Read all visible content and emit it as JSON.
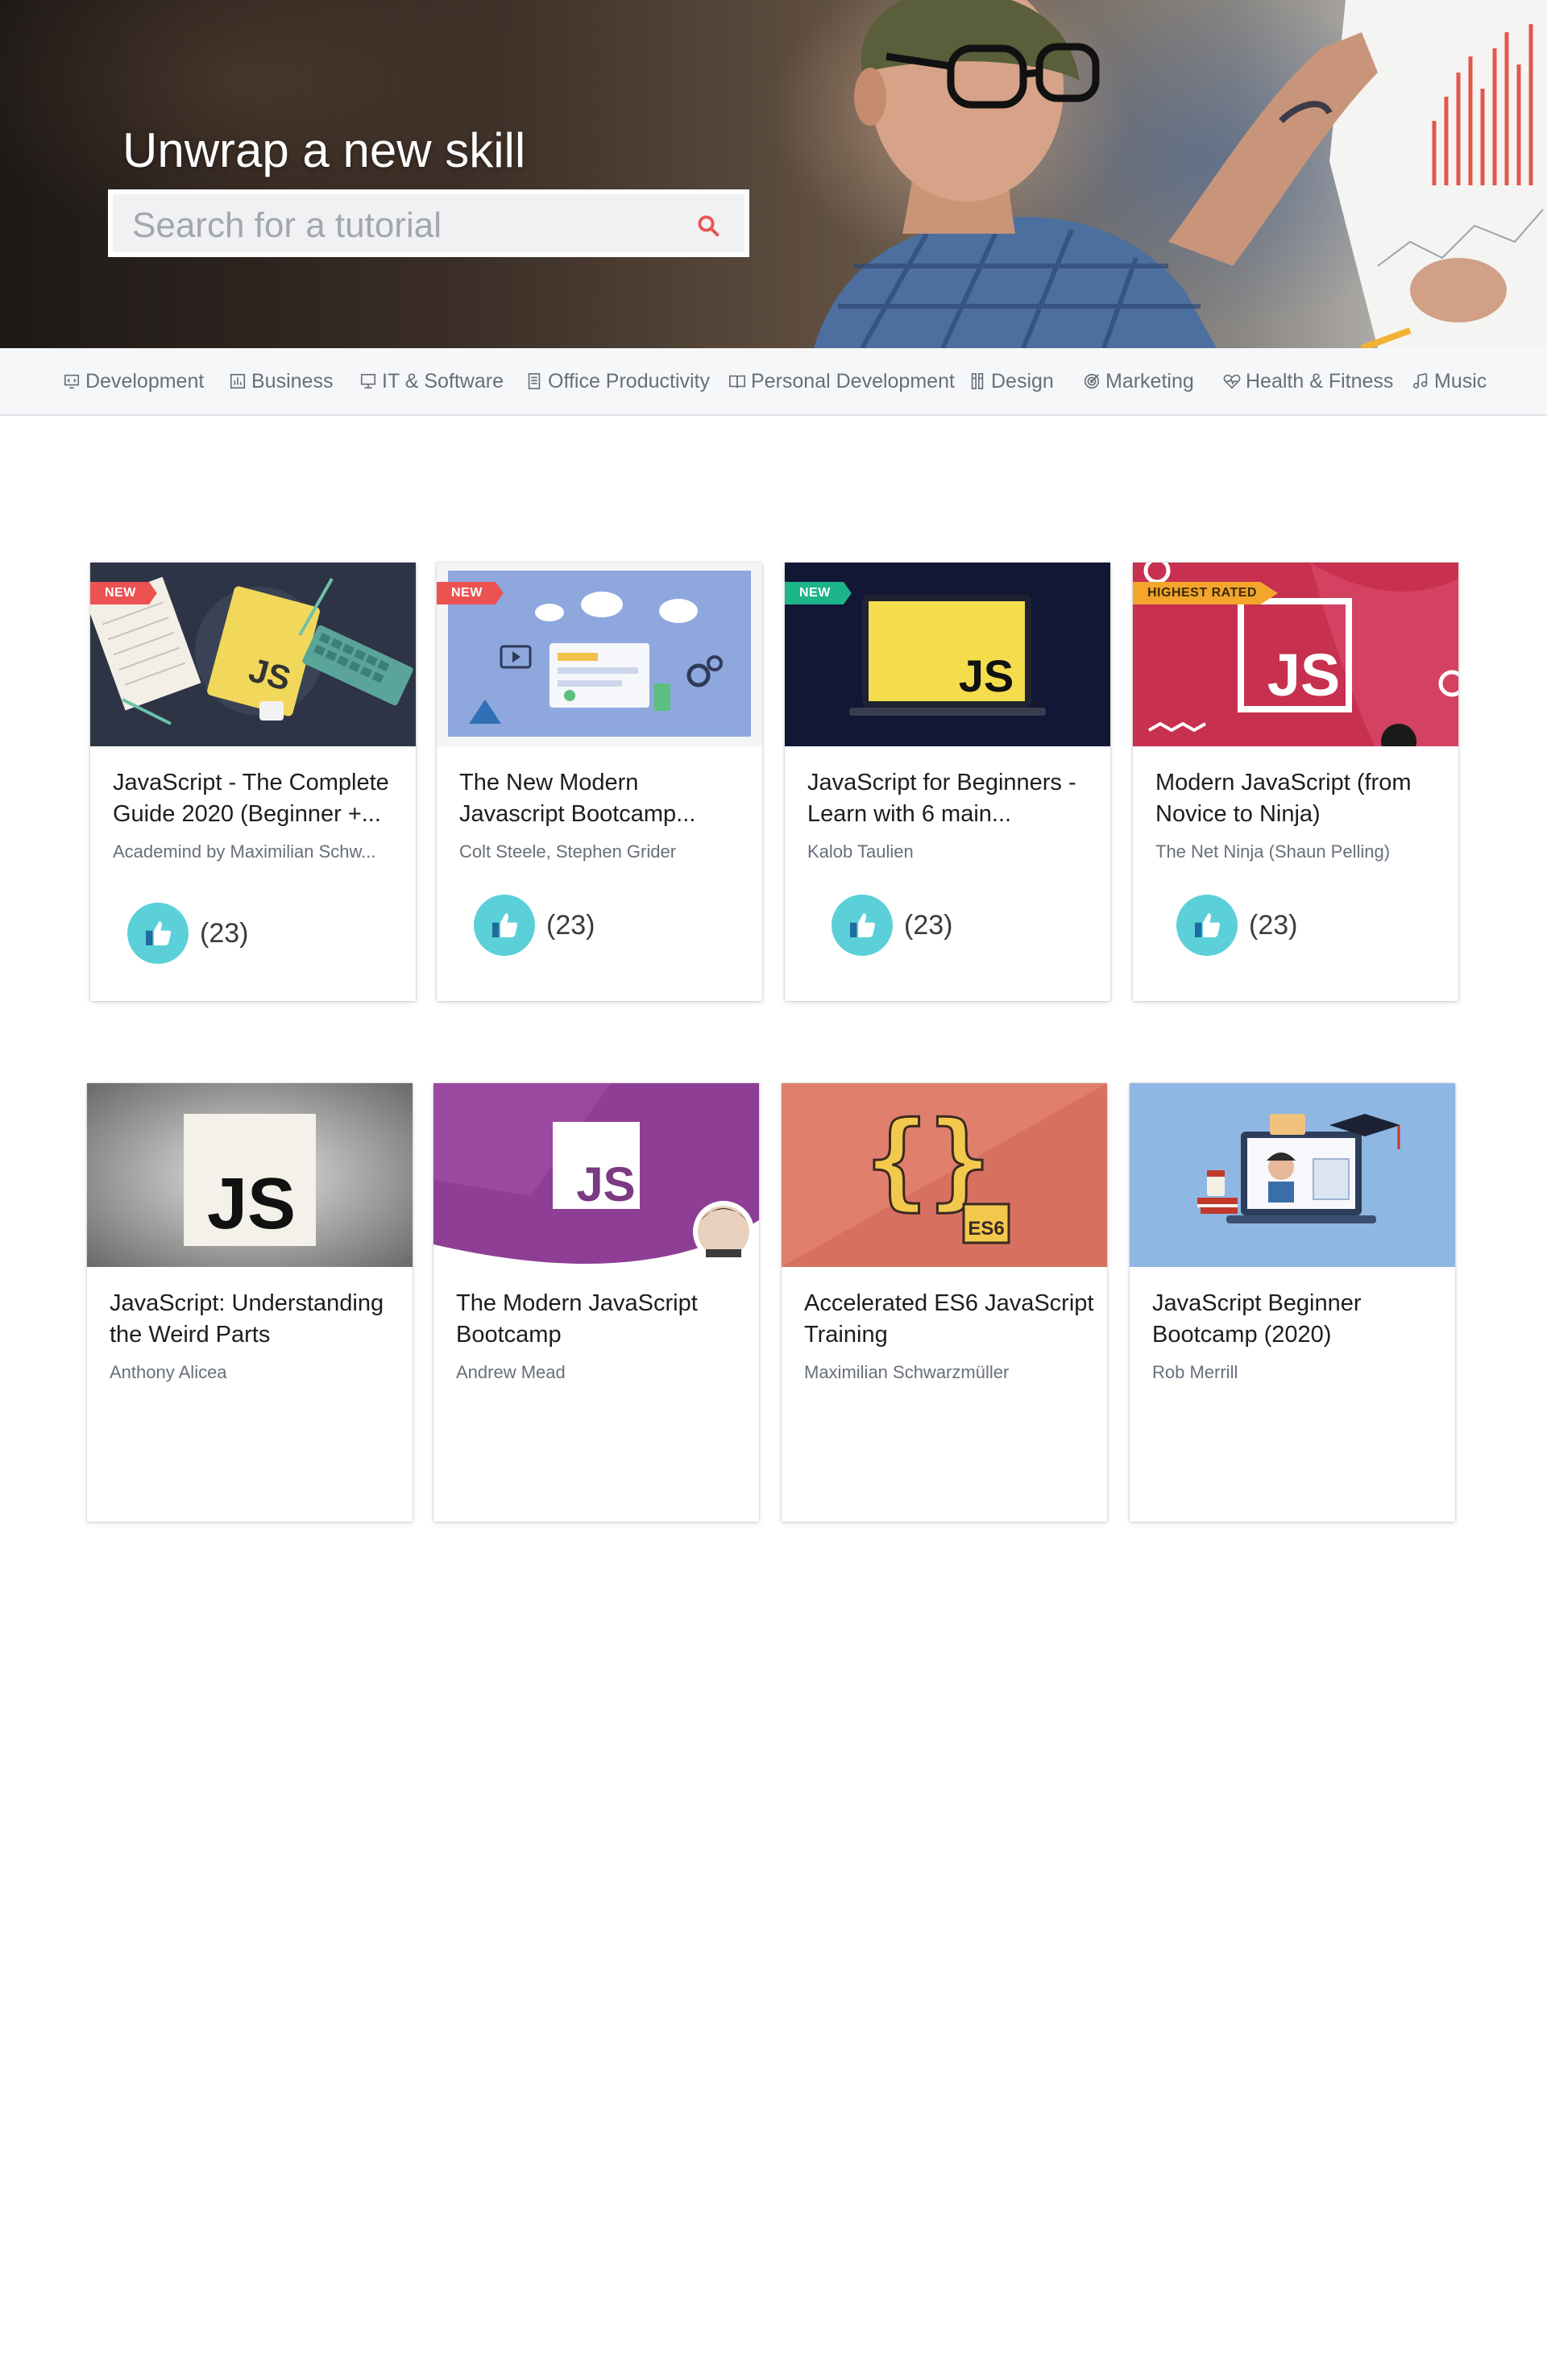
{
  "hero": {
    "title": "Unwrap a new skill",
    "search_placeholder": "Search for a tutorial"
  },
  "categories": [
    {
      "label": "Development",
      "icon": "monitor-code-icon"
    },
    {
      "label": "Business",
      "icon": "bar-chart-icon"
    },
    {
      "label": "IT & Software",
      "icon": "desktop-icon"
    },
    {
      "label": "Office Productivity",
      "icon": "document-icon"
    },
    {
      "label": "Personal Development",
      "icon": "book-icon"
    },
    {
      "label": "Design",
      "icon": "pen-tools-icon"
    },
    {
      "label": "Marketing",
      "icon": "target-icon"
    },
    {
      "label": "Health & Fitness",
      "icon": "heart-icon"
    },
    {
      "label": "Music",
      "icon": "music-note-icon"
    }
  ],
  "courses": [
    {
      "title": "JavaScript - The Complete Guide 2020 (Beginner +...",
      "author": "Academind by Maximilian Schw...",
      "badge": "NEW",
      "rating_count": "(23)"
    },
    {
      "title": "The New Modern Javascript Bootcamp...",
      "author": "Colt Steele, Stephen Grider",
      "badge": "NEW",
      "rating_count": "(23)"
    },
    {
      "title": "JavaScript for Beginners - Learn with 6 main...",
      "author": "Kalob Taulien",
      "badge": "NEW",
      "rating_count": "(23)"
    },
    {
      "title": "Modern JavaScript (from Novice to Ninja)",
      "author": "The Net Ninja (Shaun Pelling)",
      "badge": "HIGHEST RATED",
      "rating_count": "(23)"
    },
    {
      "title": "JavaScript: Understanding the Weird Parts",
      "author": "Anthony Alicea"
    },
    {
      "title": "The Modern JavaScript Bootcamp",
      "author": "Andrew Mead"
    },
    {
      "title": "Accelerated ES6 JavaScript Training",
      "author": "Maximilian Schwarzmüller"
    },
    {
      "title": "JavaScript Beginner Bootcamp (2020)",
      "author": "Rob Merrill"
    }
  ],
  "thumbnail_text": {
    "js": "JS",
    "es6": "ES6"
  },
  "colors": {
    "accent_red": "#ec5252",
    "badge_green": "#1eb48a",
    "badge_orange": "#f4a52c",
    "thumb_icon_teal": "#5bd0d9",
    "js_yellow": "#f7df1e"
  }
}
